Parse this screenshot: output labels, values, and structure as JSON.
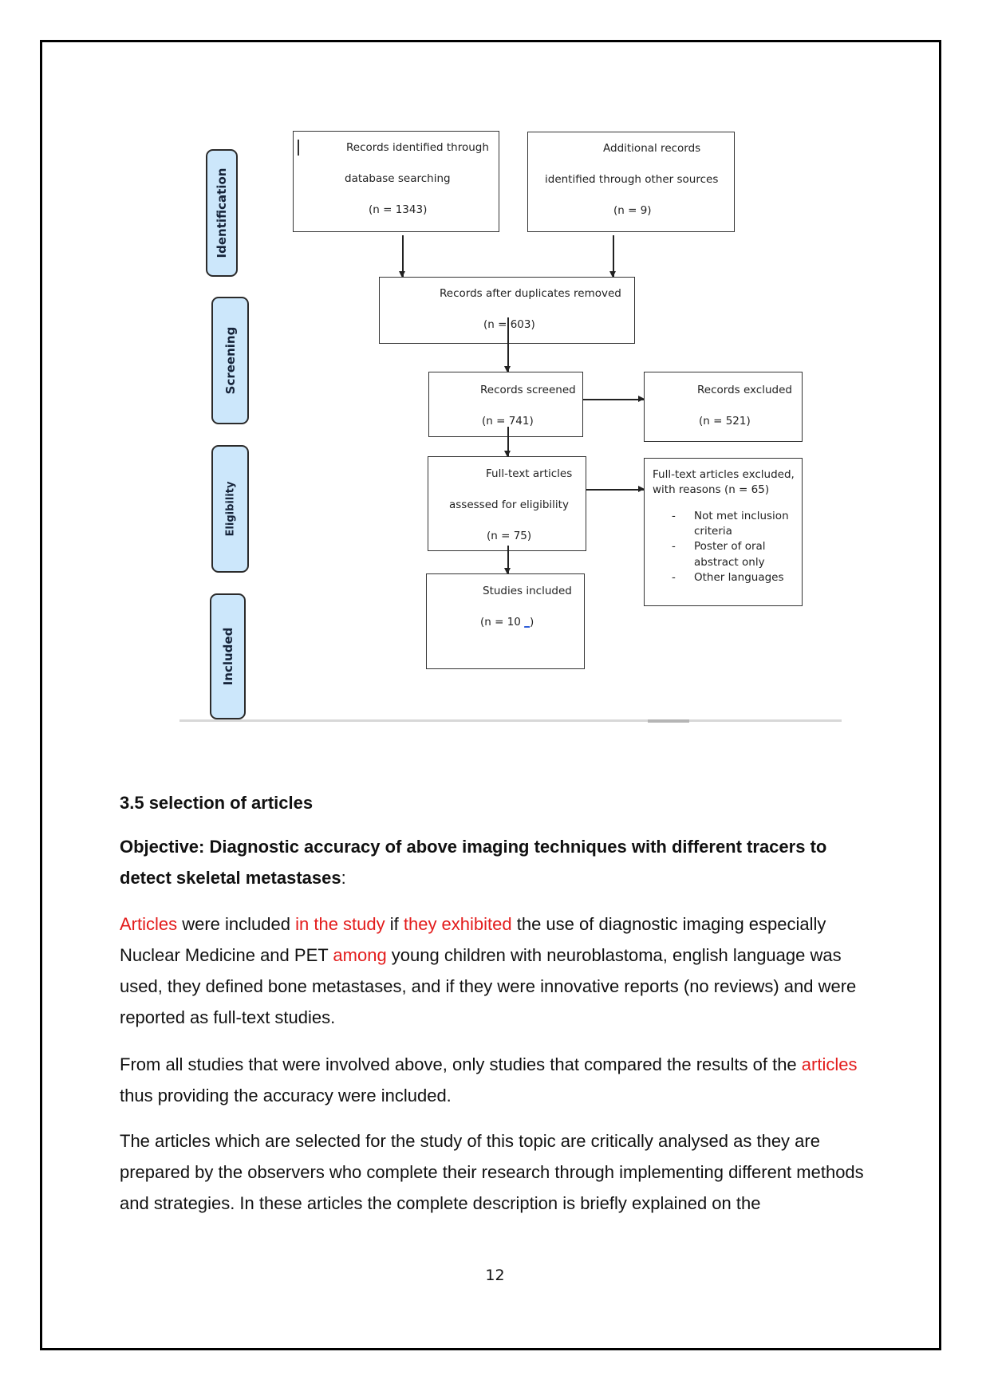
{
  "flowchart": {
    "stages": [
      {
        "label": "Identification"
      },
      {
        "label": "Screening"
      },
      {
        "label": "Eligibility"
      },
      {
        "label": "Included"
      }
    ],
    "boxes": {
      "database": {
        "lines": [
          "Records identified through",
          "database searching",
          "(n = 1343)"
        ]
      },
      "other_sources": {
        "lines": [
          "Additional records",
          "identified through other sources",
          "(n = 9)"
        ]
      },
      "duplicates_removed": {
        "lines": [
          "Records after duplicates removed",
          "(n = 603)"
        ]
      },
      "screened": {
        "lines": [
          "Records screened",
          "(n = 741)"
        ]
      },
      "excluded": {
        "lines": [
          "Records excluded",
          "(n = 521)"
        ]
      },
      "fulltext_assessed": {
        "lines": [
          "Full-text articles",
          "assessed for eligibility",
          "(n = 75)"
        ]
      },
      "fulltext_excluded": {
        "lines": [
          "Full-text articles excluded,",
          "with reasons (n = 65)"
        ],
        "reasons": [
          {
            "dash": "-",
            "lines": [
              "Not met inclusion",
              "criteria"
            ]
          },
          {
            "dash": "-",
            "lines": [
              "Poster of oral",
              "abstract only"
            ]
          },
          {
            "dash": "-",
            "lines": [
              "Other languages"
            ]
          }
        ]
      },
      "included": {
        "title": "Studies included",
        "count_prefix": "(n = 10 ",
        "count_link": "_",
        "count_suffix": ")"
      }
    }
  },
  "section": {
    "heading": "3.5 selection of articles",
    "objective_bold": "Objective: Diagnostic accuracy of above imaging techniques with different tracers to detect skeletal metastases",
    "objective_colon": ":",
    "paragraph1": [
      {
        "text": "Articles",
        "red": true
      },
      {
        "text": " were included ",
        "red": false
      },
      {
        "text": "in the study",
        "red": true
      },
      {
        "text": " if ",
        "red": false
      },
      {
        "text": "they exhibited",
        "red": true
      },
      {
        "text": " the use of diagnostic imaging especially Nuclear Medicine and PET ",
        "red": false
      },
      {
        "text": "among",
        "red": true
      },
      {
        "text": " young children with neuroblastoma, english language was used, they defined bone metastases, and if they were innovative reports (no reviews) and were reported as full-text studies.",
        "red": false
      }
    ],
    "paragraph2": [
      {
        "text": "From all studies that were involved above, only studies that compared the results of the ",
        "red": false
      },
      {
        "text": "articles",
        "red": true
      },
      {
        "text": " thus providing the accuracy were included.",
        "red": false
      }
    ],
    "paragraph3": "The articles which are selected for the study of this topic are critically analysed as they are prepared by the observers who complete their research through implementing different methods and strategies. In these articles the complete description is briefly explained on the"
  },
  "footer": {
    "page_number": "12"
  },
  "colors": {
    "highlight_red": "#e31c1c",
    "stage_fill": "#cce7fb",
    "link_blue": "#2a5ad6"
  }
}
